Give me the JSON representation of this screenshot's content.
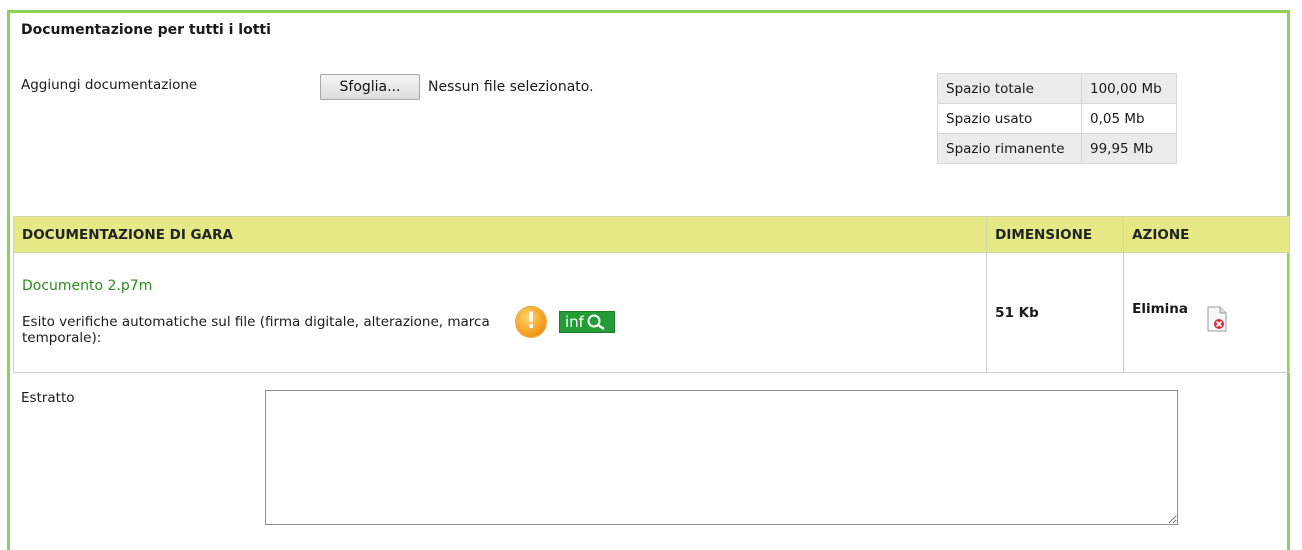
{
  "section": {
    "title": "Documentazione per tutti i lotti",
    "add_label": "Aggiungi documentazione",
    "browse_button": "Sfoglia...",
    "file_status": "Nessun file selezionato."
  },
  "space": {
    "rows": [
      {
        "label": "Spazio totale",
        "value": "100,00 Mb"
      },
      {
        "label": "Spazio usato",
        "value": "0,05 Mb"
      },
      {
        "label": "Spazio rimanente",
        "value": "99,95 Mb"
      }
    ]
  },
  "docs_table": {
    "headers": [
      "DOCUMENTAZIONE DI GARA",
      "DIMENSIONE",
      "AZIONE"
    ],
    "rows": [
      {
        "name": "Documento 2.p7m",
        "verify_text": "Esito verifiche automatiche sul file (firma digitale, alterazione, marca temporale):",
        "warning_icon": "warning-icon",
        "warning_glyph": "!",
        "info_icon": "info-search-icon",
        "info_text": "inf",
        "size": "51 Kb",
        "action_label": "Elimina",
        "action_icon": "delete-file-icon"
      }
    ]
  },
  "estratto": {
    "label": "Estratto",
    "value": ""
  },
  "colors": {
    "panel_border": "#8fd05a",
    "header_bg": "#e5e985",
    "doc_link": "#2e8b1e",
    "info_badge": "#239c35",
    "warning": "#f29b1b"
  }
}
